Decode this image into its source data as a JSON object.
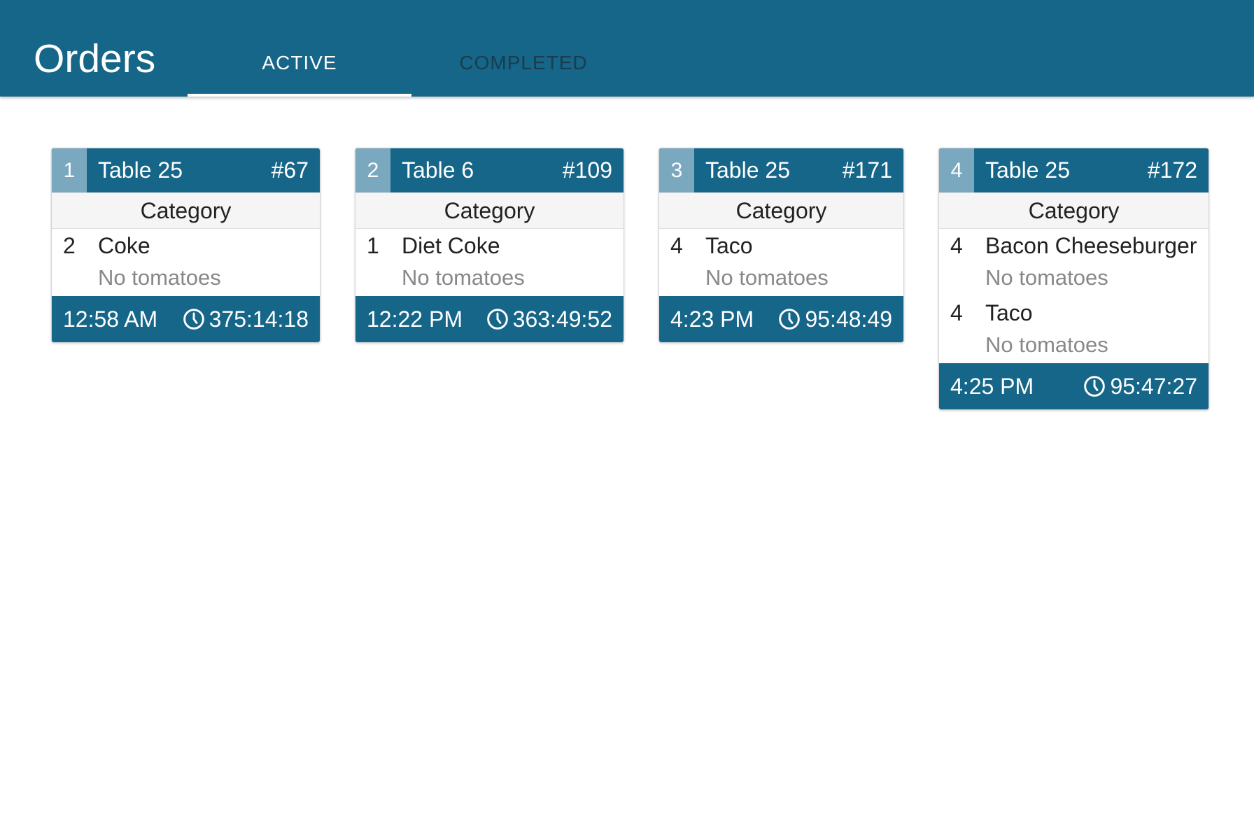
{
  "app": {
    "title": "Orders",
    "tabs": [
      {
        "label": "ACTIVE",
        "selected": true
      },
      {
        "label": "COMPLETED",
        "selected": false
      }
    ],
    "colors": {
      "primary": "#156688",
      "index_badge": "#7aa8bf",
      "modifier_text": "#888888"
    }
  },
  "orders": [
    {
      "index": "1",
      "table": "Table 25",
      "number": "#67",
      "category": "Category",
      "items": [
        {
          "qty": "2",
          "name": "Coke",
          "modifier": "No tomatoes"
        }
      ],
      "time": "12:58 AM",
      "elapsed": "375:14:18"
    },
    {
      "index": "2",
      "table": "Table 6",
      "number": "#109",
      "category": "Category",
      "items": [
        {
          "qty": "1",
          "name": "Diet Coke",
          "modifier": "No tomatoes"
        }
      ],
      "time": "12:22 PM",
      "elapsed": "363:49:52"
    },
    {
      "index": "3",
      "table": "Table 25",
      "number": "#171",
      "category": "Category",
      "items": [
        {
          "qty": "4",
          "name": "Taco",
          "modifier": "No tomatoes"
        }
      ],
      "time": "4:23 PM",
      "elapsed": "95:48:49"
    },
    {
      "index": "4",
      "table": "Table 25",
      "number": "#172",
      "category": "Category",
      "items": [
        {
          "qty": "4",
          "name": "Bacon Cheeseburger",
          "modifier": "No tomatoes"
        },
        {
          "qty": "4",
          "name": "Taco",
          "modifier": "No tomatoes"
        }
      ],
      "time": "4:25 PM",
      "elapsed": "95:47:27"
    }
  ]
}
